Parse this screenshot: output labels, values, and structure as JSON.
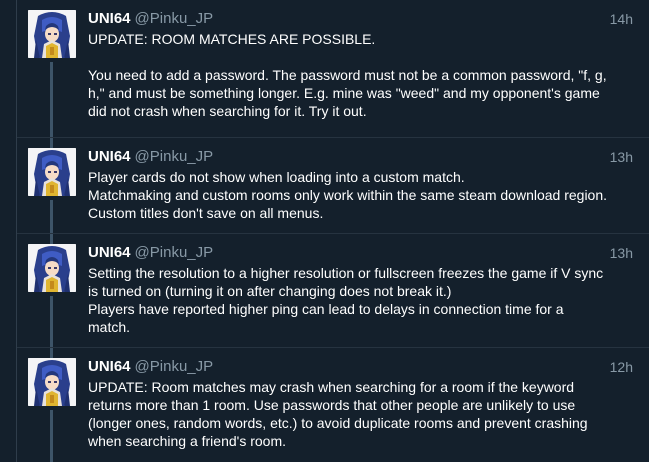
{
  "tweets": [
    {
      "name": "UNI64",
      "handle": "@Pinku_JP",
      "time": "14h",
      "lines": [
        "UPDATE: ROOM MATCHES ARE POSSIBLE.",
        "",
        "You need to add a password. The password must not be a common password, \"f, g,",
        "h,\" and must be something longer. E.g. mine was \"weed\" and my opponent's game",
        "did not crash when searching for it. Try it out."
      ]
    },
    {
      "name": "UNI64",
      "handle": "@Pinku_JP",
      "time": "13h",
      "lines": [
        "Player cards do not show when loading into a custom match.",
        "Matchmaking and custom rooms only work within the same steam download region.",
        "Custom titles don't save on all menus."
      ]
    },
    {
      "name": "UNI64",
      "handle": "@Pinku_JP",
      "time": "13h",
      "lines": [
        "Setting the resolution to a higher resolution or fullscreen freezes the game if V sync",
        "is turned on (turning it on after changing does not break it.)",
        "Players have reported higher ping can lead to delays in connection time for a",
        "match."
      ]
    },
    {
      "name": "UNI64",
      "handle": "@Pinku_JP",
      "time": "12h",
      "lines": [
        "UPDATE: Room matches may crash when searching for a room if the keyword",
        "returns more than 1 room. Use passwords that other people are unlikely to use",
        "(longer ones, random words, etc.) to avoid duplicate rooms and prevent crashing",
        "when searching a friend's room."
      ]
    }
  ]
}
